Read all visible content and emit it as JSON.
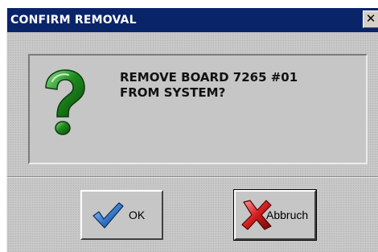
{
  "window": {
    "title": "CONFIRM REMOVAL",
    "close_glyph": "✕",
    "title_color": "#0a246a"
  },
  "message": "REMOVE BOARD 7265 #01\nFROM SYSTEM?",
  "icons": {
    "message": "question-mark-icon",
    "ok": "checkmark-icon",
    "cancel": "red-x-icon"
  },
  "buttons": {
    "ok_label": "OK",
    "cancel_label": "Abbruch"
  },
  "colors": {
    "question": "#1e8a1e",
    "check": "#3a7fd0",
    "cross": "#d41c1c"
  }
}
